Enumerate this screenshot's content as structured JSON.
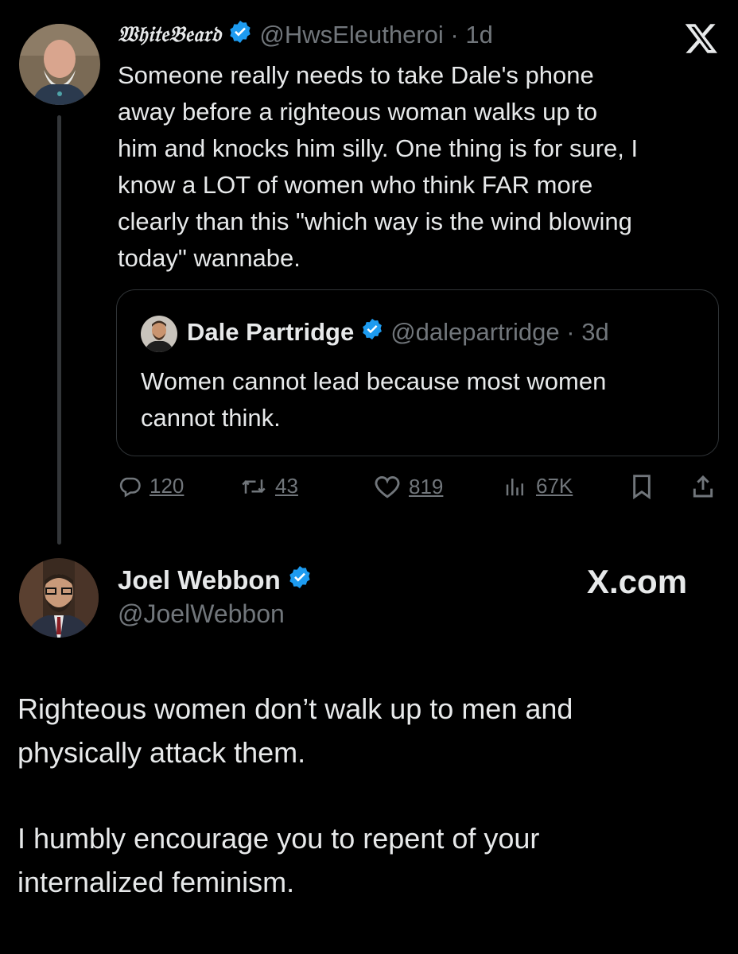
{
  "tweet1": {
    "display_name": "𝔚𝔥𝔦𝔱𝔢𝔅𝔢𝔞𝔯𝔡",
    "handle": "@HwsEleutheroi",
    "time": "1d",
    "text_lines": [
      "Someone really needs to take Dale's phone",
      "away before a righteous woman walks up to",
      "him and knocks him silly.  One thing is for sure, I",
      "know a LOT of women who think FAR more",
      "clearly than this \"which way is the wind blowing",
      "today\" wannabe."
    ],
    "quote": {
      "display_name": "Dale Partridge",
      "handle": "@dalepartridge",
      "time": "3d",
      "text_lines": [
        "Women cannot lead because most women",
        "cannot think."
      ]
    },
    "actions": {
      "replies": "120",
      "retweets": "43",
      "likes": "819",
      "views": "67K"
    }
  },
  "tweet2": {
    "display_name": "Joel Webbon",
    "handle": "@JoelWebbon",
    "brand": "X.com",
    "text_lines_1": [
      "Righteous women don’t walk up to men and",
      "physically attack them."
    ],
    "text_lines_2": [
      "I humbly encourage you to repent of your",
      "internalized feminism."
    ]
  },
  "icons": {
    "verified": "verified-badge-icon",
    "x_logo": "x-logo-icon",
    "reply": "reply-icon",
    "retweet": "retweet-icon",
    "like": "heart-icon",
    "views": "views-icon",
    "bookmark": "bookmark-icon",
    "share": "share-icon"
  },
  "colors": {
    "background": "#000000",
    "text": "#e7e9ea",
    "muted": "#71767b",
    "verified": "#1d9bf0",
    "border": "#2f3336"
  }
}
